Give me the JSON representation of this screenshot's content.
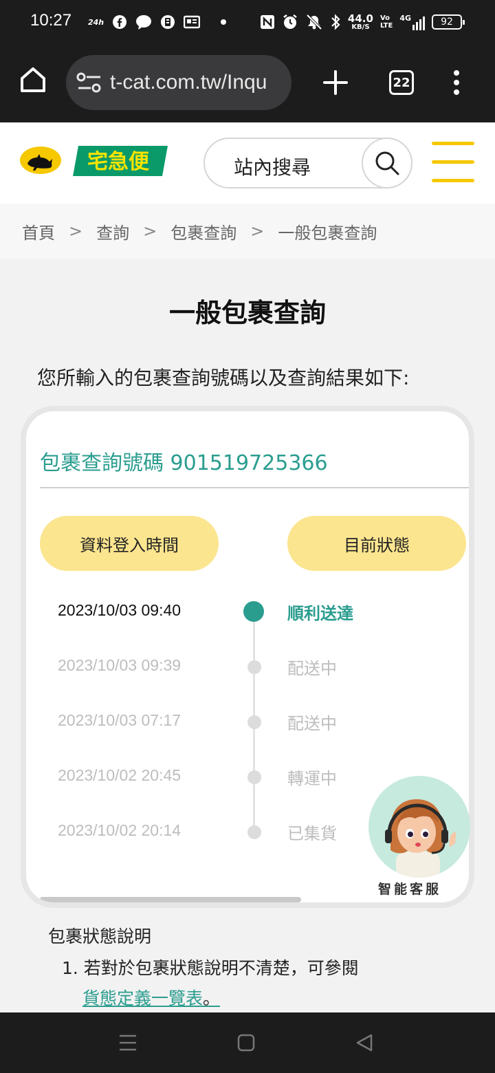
{
  "status_bar": {
    "time": "10:27",
    "left_icons": [
      "24h-icon",
      "facebook-icon",
      "messenger-icon",
      "app-icon",
      "news-icon"
    ],
    "speed_value": "44.0",
    "speed_unit": "KB/S",
    "volte": "Vo\nLTE",
    "network": "4G",
    "battery": "92"
  },
  "browser": {
    "url": "t-cat.com.tw/Inqu",
    "tab_count": "22"
  },
  "header": {
    "brand_text": "宅急便",
    "search_label": "站內搜尋"
  },
  "breadcrumb": [
    "首頁",
    "查詢",
    "包裹查詢",
    "一般包裹查詢"
  ],
  "page": {
    "title": "一般包裹查詢",
    "intro": "您所輸入的包裹查詢號碼以及查詢結果如下:"
  },
  "card": {
    "tracking_label": "包裹查詢號碼 901519725366",
    "col_time": "資料登入時間",
    "col_status": "目前狀態",
    "events": [
      {
        "time": "2023/10/03 09:40",
        "status": "順利送達",
        "active": true
      },
      {
        "time": "2023/10/03 09:39",
        "status": "配送中",
        "active": false
      },
      {
        "time": "2023/10/03 07:17",
        "status": "配送中",
        "active": false
      },
      {
        "time": "2023/10/02 20:45",
        "status": "轉運中",
        "active": false
      },
      {
        "time": "2023/10/02 20:14",
        "status": "已集貨",
        "active": false
      }
    ]
  },
  "assistant": {
    "label": "智能客服"
  },
  "description": {
    "title": "包裹狀態說明",
    "item1": "1. 若對於包裹狀態說明不清楚，可參閱",
    "link": "貨態定義一覽表",
    "link_tail": "。"
  },
  "colors": {
    "accent": "#2a9d8f",
    "pill": "#fbe58f",
    "brand_yellow": "#f5c800",
    "brand_green": "#0a9a6a"
  }
}
